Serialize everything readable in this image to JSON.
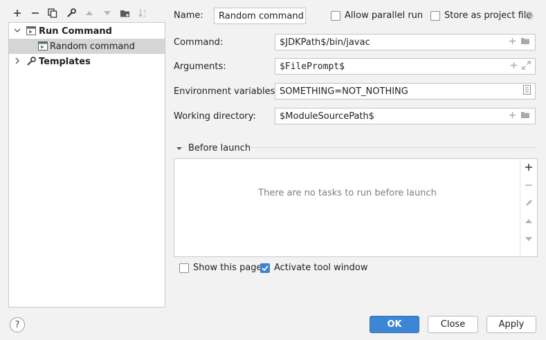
{
  "toolbar": {
    "icons": [
      "add-icon",
      "remove-icon",
      "copy-icon",
      "wrench-icon",
      "arrow-up-icon",
      "arrow-down-icon",
      "new-folder-icon",
      "sort-icon"
    ]
  },
  "tree": {
    "items": [
      {
        "label": "Run Command",
        "bold": true,
        "expanded": true
      },
      {
        "label": "Random command",
        "selected": true
      },
      {
        "label": "Templates",
        "bold": true,
        "expanded": false
      }
    ]
  },
  "form": {
    "name_label": "Name:",
    "name_value": "Random command",
    "allow_parallel_label": "Allow parallel run",
    "allow_parallel_checked": false,
    "store_project_label": "Store as project file",
    "store_project_checked": false,
    "command_label": "Command:",
    "command_value": "$JDKPath$/bin/javac",
    "arguments_label": "Arguments:",
    "arguments_value": "$FilePrompt$",
    "env_label": "Environment variables:",
    "env_value": "SOMETHING=NOT_NOTHING",
    "workdir_label": "Working directory:",
    "workdir_value": "$ModuleSourcePath$"
  },
  "before_launch": {
    "title": "Before launch",
    "empty_text": "There are no tasks to run before launch"
  },
  "options": {
    "show_page_label": "Show this page",
    "show_page_checked": false,
    "activate_tool_label": "Activate tool window",
    "activate_tool_checked": true
  },
  "buttons": {
    "help": "?",
    "ok": "OK",
    "close": "Close",
    "apply": "Apply"
  },
  "colors": {
    "accent": "#3d85d5",
    "selection": "#d5d5d5"
  }
}
